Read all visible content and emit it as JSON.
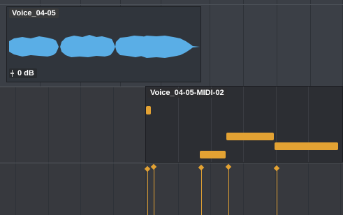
{
  "audio_clip": {
    "title": "Voice_04-05",
    "gain": "0 dB",
    "gain_icon": "fader-icon",
    "color": "#5aaee6"
  },
  "midi_clip": {
    "title": "Voice_04-05-MIDI-02",
    "note_color": "#e3a233"
  },
  "colors": {
    "background": "#3a3e44",
    "audio_background": "#32363d",
    "midi_background": "#2f3136"
  }
}
